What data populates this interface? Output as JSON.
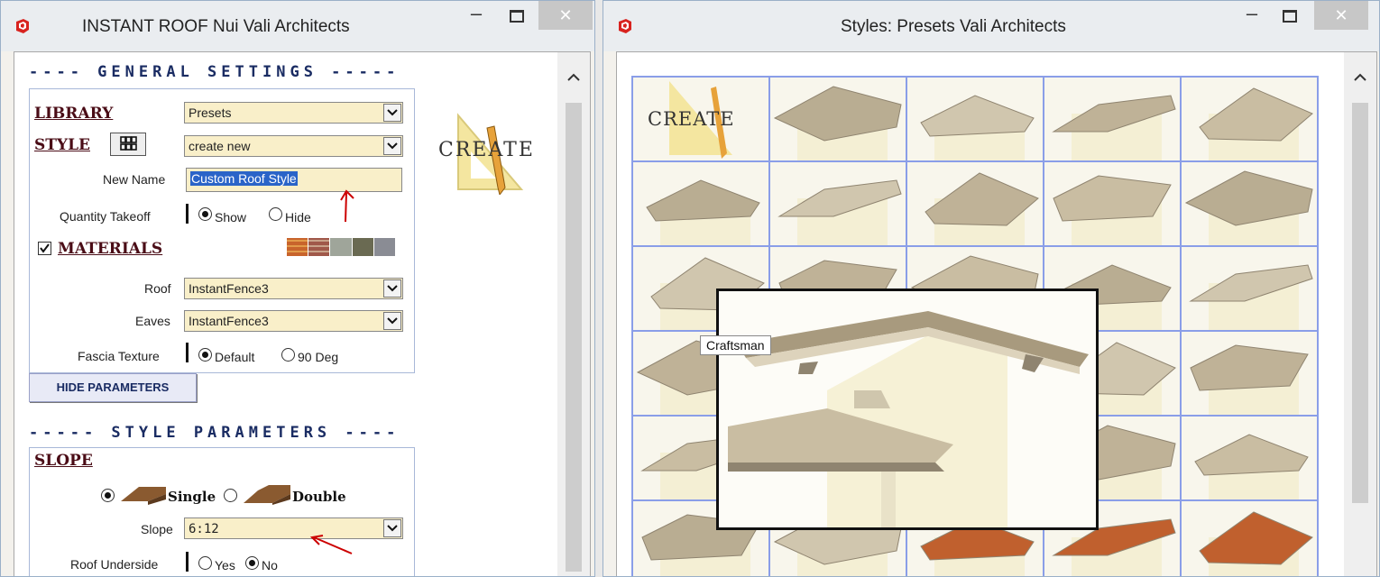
{
  "left_window": {
    "title": "INSTANT ROOF Nui   Vali Architects",
    "controls": {
      "minimize": "–",
      "close": "✕"
    },
    "general_settings": {
      "heading": "---- GENERAL  SETTINGS -----",
      "library_label": "LIBRARY",
      "library_value": "Presets",
      "style_label": "STYLE",
      "style_value": "create new",
      "create_logo_text": "CREATE",
      "new_name_label": "New Name",
      "new_name_value": "Custom Roof Style",
      "quantity_takeoff_label": "Quantity Takeoff",
      "quantity_takeoff_options": [
        "Show",
        "Hide"
      ],
      "quantity_takeoff_selected": "Show",
      "materials_label": "MATERIALS",
      "materials_checked": true,
      "roof_label": "Roof",
      "roof_value": "InstantFence3",
      "eaves_label": "Eaves",
      "eaves_value": "InstantFence3",
      "fascia_label": "Fascia Texture",
      "fascia_options": [
        "Default",
        "90 Deg"
      ],
      "fascia_selected": "Default",
      "hide_parameters_button": "HIDE PARAMETERS"
    },
    "style_parameters": {
      "heading": "----- STYLE  PARAMETERS ----",
      "slope_label": "SLOPE",
      "slope_options": [
        "Single",
        "Double"
      ],
      "slope_selected": "Single",
      "slope_field_label": "Slope",
      "slope_value": "6:12",
      "roof_underside_label": "Roof Underside",
      "roof_underside_options": [
        "Yes",
        "No"
      ],
      "roof_underside_selected": "No"
    }
  },
  "right_window": {
    "title": "Styles: Presets   Vali Architects",
    "controls": {
      "minimize": "–",
      "close": "✕"
    },
    "grid_first_cell_text": "CREATE",
    "tooltip_label": "Craftsman"
  },
  "colors": {
    "accent_navy": "#1a2c63",
    "label_maroon": "#4a0c16",
    "field_fill": "#f9efc9",
    "grid_line": "#8a9ee8",
    "annotation_red": "#cc0000"
  }
}
